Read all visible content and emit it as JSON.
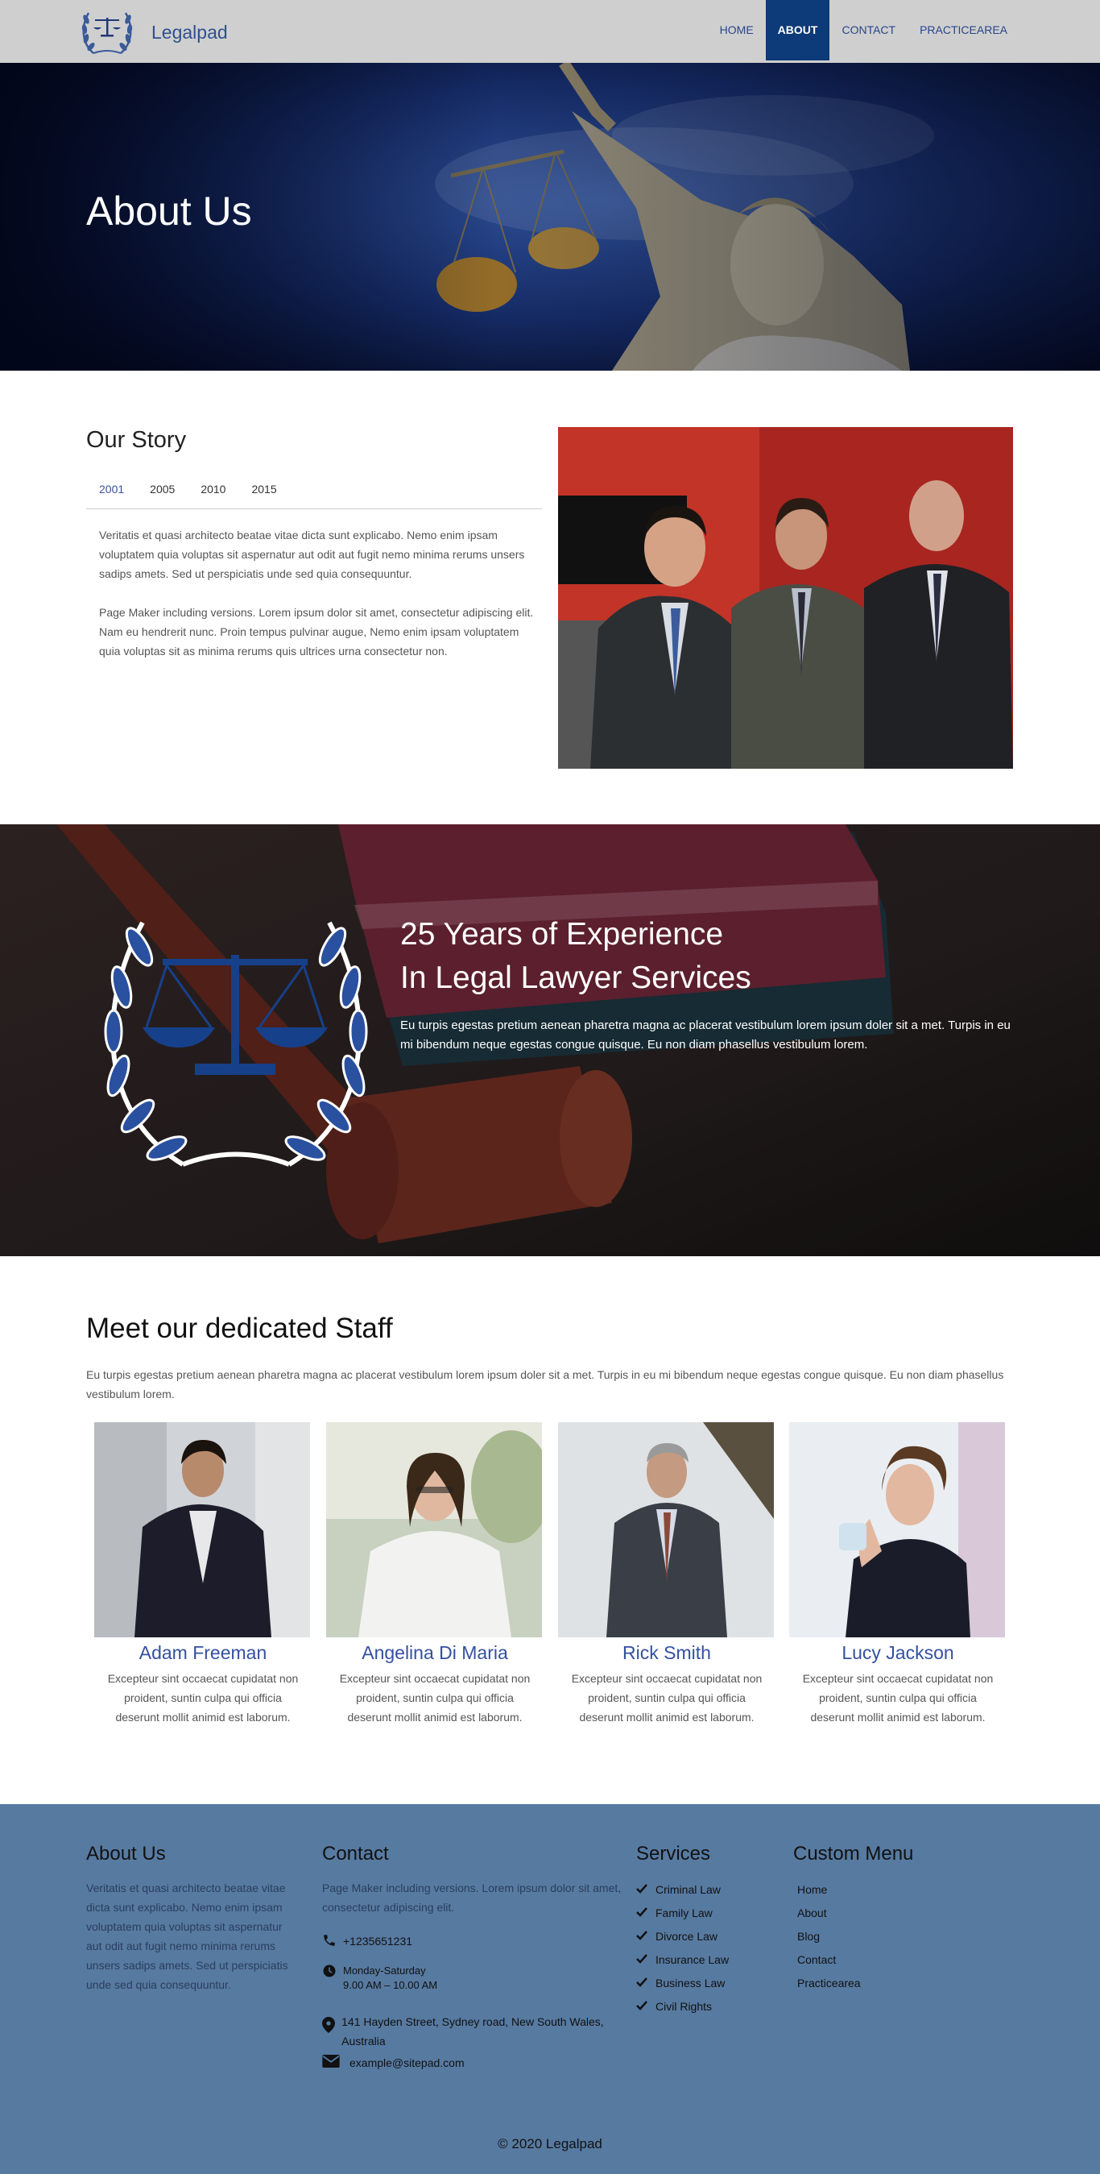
{
  "brand": {
    "name": "Legalpad",
    "logo_icon": "scales-laurel-icon"
  },
  "nav": {
    "items": [
      {
        "label": "HOME",
        "active": false
      },
      {
        "label": "ABOUT",
        "active": true
      },
      {
        "label": "CONTACT",
        "active": false
      },
      {
        "label": "PRACTICEAREA",
        "active": false
      }
    ]
  },
  "hero": {
    "title": "About Us"
  },
  "story": {
    "title": "Our Story",
    "tabs": [
      "2001",
      "2005",
      "2010",
      "2015"
    ],
    "active_tab": "2001",
    "paragraphs": [
      "Veritatis et quasi architecto beatae vitae dicta sunt explicabo. Nemo enim ipsam voluptatem quia voluptas sit aspernatur aut odit aut fugit nemo minima rerums unsers sadips amets. Sed ut perspiciatis unde sed quia consequuntur.",
      "Page Maker including versions. Lorem ipsum dolor sit amet, consectetur adipiscing elit. Nam eu hendrerit nunc. Proin tempus pulvinar augue, Nemo enim ipsam voluptatem quia voluptas sit as minima rerums quis ultrices urna consectetur non."
    ]
  },
  "experience": {
    "heading_line1": "25 Years of Experience",
    "heading_line2": "In Legal Lawyer Services",
    "text": "Eu turpis egestas pretium aenean pharetra magna ac placerat vestibulum lorem ipsum doler sit a met. Turpis in eu mi bibendum neque egestas congue quisque. Eu non diam phasellus vestibulum lorem."
  },
  "staff": {
    "title": "Meet our dedicated Staff",
    "intro": "Eu turpis egestas pretium aenean pharetra magna ac placerat vestibulum lorem ipsum doler sit a met. Turpis in eu mi bibendum neque egestas congue quisque. Eu non diam phasellus vestibulum lorem.",
    "members": [
      {
        "name": "Adam Freeman",
        "desc": "Excepteur sint occaecat cupidatat non proident, suntin culpa qui officia deserunt mollit animid est laborum."
      },
      {
        "name": "Angelina Di Maria",
        "desc": "Excepteur sint occaecat cupidatat non proident, suntin culpa qui officia deserunt mollit animid est laborum."
      },
      {
        "name": "Rick Smith",
        "desc": "Excepteur sint occaecat cupidatat non proident, suntin culpa qui officia deserunt mollit animid est laborum."
      },
      {
        "name": "Lucy Jackson",
        "desc": "Excepteur sint occaecat cupidatat non proident, suntin culpa qui officia deserunt mollit animid est laborum."
      }
    ]
  },
  "footer": {
    "about": {
      "title": "About Us",
      "text": "Veritatis et quasi architecto beatae vitae dicta sunt explicabo. Nemo enim ipsam voluptatem quia voluptas sit aspernatur aut odit aut fugit nemo minima rerums unsers sadips amets. Sed ut perspiciatis unde sed quia consequuntur."
    },
    "contact": {
      "title": "Contact",
      "text": "Page Maker including versions. Lorem ipsum dolor sit amet, consectetur adipiscing elit.",
      "phone": "+1235651231",
      "hours_line1": "Monday-Saturday",
      "hours_line2": "9.00 AM – 10.00 AM",
      "address": "141 Hayden Street, Sydney road, New South Wales, Australia",
      "email": "example@sitepad.com"
    },
    "services": {
      "title": "Services",
      "items": [
        "Criminal Law",
        "Family Law",
        "Divorce Law",
        "Insurance Law",
        "Business Law",
        "Civil Rights"
      ]
    },
    "custom_menu": {
      "title": "Custom Menu",
      "items": [
        "Home",
        "About",
        "Blog",
        "Contact",
        "Practicearea"
      ]
    },
    "copyright": "© 2020 Legalpad"
  },
  "colors": {
    "nav_bg": "#cfcfcf",
    "nav_active": "#0d3a78",
    "accent_blue": "#3450a0",
    "footer_bg": "#577aa1"
  }
}
